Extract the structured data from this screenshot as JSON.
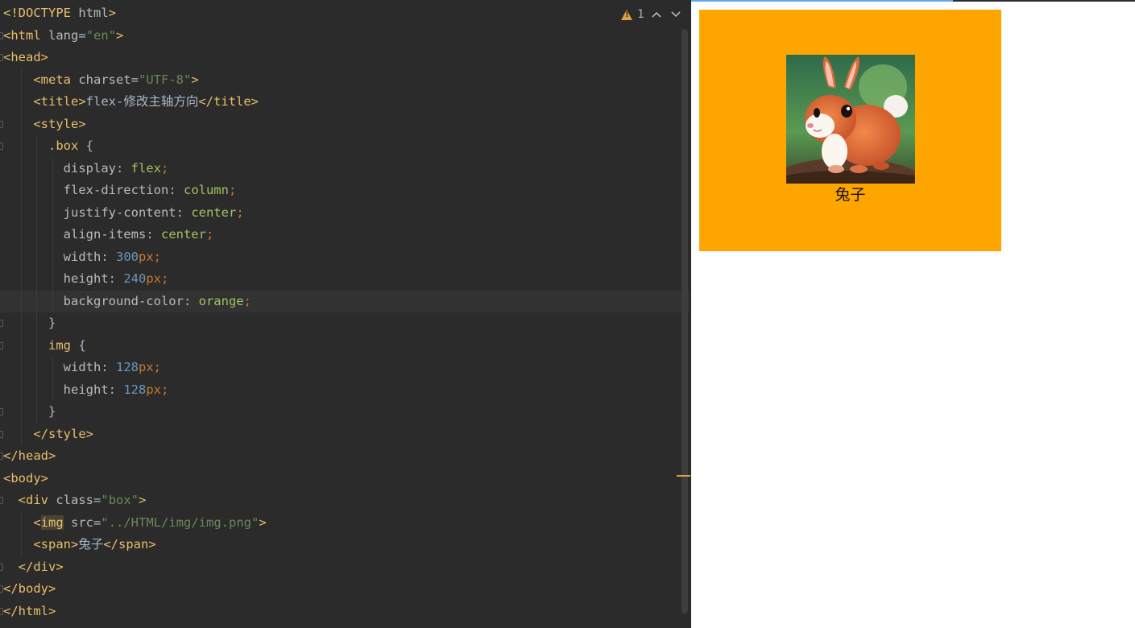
{
  "editor": {
    "inspections": {
      "warning_count": "1"
    },
    "lines": [
      {
        "indent": "",
        "tokens": [
          [
            "t-tag",
            "<!DOCTYPE "
          ],
          [
            "t-attr",
            "html"
          ],
          [
            "t-tag",
            ">"
          ]
        ]
      },
      {
        "indent": "",
        "tokens": [
          [
            "t-tag",
            "<html "
          ],
          [
            "t-attr",
            "lang"
          ],
          [
            "t-txt",
            "="
          ],
          [
            "t-str",
            "\"en\""
          ],
          [
            "t-tag",
            ">"
          ]
        ]
      },
      {
        "indent": "",
        "tokens": [
          [
            "t-tag",
            "<head>"
          ]
        ]
      },
      {
        "indent": "    ",
        "tokens": [
          [
            "t-tag",
            "<meta "
          ],
          [
            "t-attr",
            "charset"
          ],
          [
            "t-txt",
            "="
          ],
          [
            "t-str",
            "\"UTF-8\""
          ],
          [
            "t-tag",
            ">"
          ]
        ]
      },
      {
        "indent": "    ",
        "tokens": [
          [
            "t-tag",
            "<title>"
          ],
          [
            "t-txt",
            "flex-修改主轴方向"
          ],
          [
            "t-tag",
            "</title>"
          ]
        ]
      },
      {
        "indent": "    ",
        "tokens": [
          [
            "t-tag",
            "<style>"
          ]
        ]
      },
      {
        "indent": "      ",
        "tokens": [
          [
            "t-sel",
            ".box "
          ],
          [
            "t-txt",
            "{"
          ]
        ]
      },
      {
        "indent": "        ",
        "tokens": [
          [
            "t-prop",
            "display"
          ],
          [
            "t-txt",
            ": "
          ],
          [
            "t-val",
            "flex"
          ],
          [
            "t-punct",
            ";"
          ]
        ]
      },
      {
        "indent": "        ",
        "tokens": [
          [
            "t-prop",
            "flex-direction"
          ],
          [
            "t-txt",
            ": "
          ],
          [
            "t-val",
            "column"
          ],
          [
            "t-punct",
            ";"
          ]
        ]
      },
      {
        "indent": "        ",
        "tokens": [
          [
            "t-prop",
            "justify-content"
          ],
          [
            "t-txt",
            ": "
          ],
          [
            "t-val",
            "center"
          ],
          [
            "t-punct",
            ";"
          ]
        ]
      },
      {
        "indent": "        ",
        "tokens": [
          [
            "t-prop",
            "align-items"
          ],
          [
            "t-txt",
            ": "
          ],
          [
            "t-val",
            "center"
          ],
          [
            "t-punct",
            ";"
          ]
        ]
      },
      {
        "indent": "        ",
        "tokens": [
          [
            "t-prop",
            "width"
          ],
          [
            "t-txt",
            ": "
          ],
          [
            "t-num",
            "300"
          ],
          [
            "t-unit",
            "px"
          ],
          [
            "t-punct",
            ";"
          ]
        ]
      },
      {
        "indent": "        ",
        "tokens": [
          [
            "t-prop",
            "height"
          ],
          [
            "t-txt",
            ": "
          ],
          [
            "t-num",
            "240"
          ],
          [
            "t-unit",
            "px"
          ],
          [
            "t-punct",
            ";"
          ]
        ]
      },
      {
        "indent": "        ",
        "tokens": [
          [
            "t-prop",
            "background-color"
          ],
          [
            "t-txt",
            ": "
          ],
          [
            "t-val",
            "orange"
          ],
          [
            "t-punct",
            ";"
          ]
        ],
        "current": true
      },
      {
        "indent": "      ",
        "tokens": [
          [
            "t-txt",
            "}"
          ]
        ]
      },
      {
        "indent": "      ",
        "tokens": [
          [
            "t-sel",
            "img "
          ],
          [
            "t-txt",
            "{"
          ]
        ]
      },
      {
        "indent": "        ",
        "tokens": [
          [
            "t-prop",
            "width"
          ],
          [
            "t-txt",
            ": "
          ],
          [
            "t-num",
            "128"
          ],
          [
            "t-unit",
            "px"
          ],
          [
            "t-punct",
            ";"
          ]
        ]
      },
      {
        "indent": "        ",
        "tokens": [
          [
            "t-prop",
            "height"
          ],
          [
            "t-txt",
            ": "
          ],
          [
            "t-num",
            "128"
          ],
          [
            "t-unit",
            "px"
          ],
          [
            "t-punct",
            ";"
          ]
        ]
      },
      {
        "indent": "      ",
        "tokens": [
          [
            "t-txt",
            "}"
          ]
        ]
      },
      {
        "indent": "    ",
        "tokens": [
          [
            "t-tag",
            "</style>"
          ]
        ]
      },
      {
        "indent": "",
        "tokens": [
          [
            "t-tag",
            "</head>"
          ]
        ]
      },
      {
        "indent": "",
        "tokens": [
          [
            "t-tag",
            "<body>"
          ]
        ]
      },
      {
        "indent": "  ",
        "tokens": [
          [
            "t-tag",
            "<div "
          ],
          [
            "t-attr",
            "class"
          ],
          [
            "t-txt",
            "="
          ],
          [
            "t-str",
            "\"box\""
          ],
          [
            "t-tag",
            ">"
          ]
        ]
      },
      {
        "indent": "    ",
        "tokens": [
          [
            "t-tag",
            "<"
          ],
          [
            "t-hl",
            "img"
          ],
          [
            "t-tag",
            " "
          ],
          [
            "t-attr",
            "src"
          ],
          [
            "t-txt",
            "="
          ],
          [
            "t-str",
            "\"../HTML/img/img.png\""
          ],
          [
            "t-tag",
            ">"
          ]
        ]
      },
      {
        "indent": "    ",
        "tokens": [
          [
            "t-tag",
            "<span>"
          ],
          [
            "t-txt",
            "兔子"
          ],
          [
            "t-tag",
            "</span>"
          ]
        ]
      },
      {
        "indent": "  ",
        "tokens": [
          [
            "t-tag",
            "</div>"
          ]
        ]
      },
      {
        "indent": "",
        "tokens": [
          [
            "t-tag",
            "</body>"
          ]
        ]
      },
      {
        "indent": "",
        "tokens": [
          [
            "t-tag",
            "</html>"
          ]
        ]
      }
    ],
    "fold_markers": [
      1,
      2,
      5,
      6,
      14,
      15,
      18,
      19,
      20,
      22,
      25,
      26,
      27
    ]
  },
  "preview": {
    "box_color": "#ffa500",
    "image_icon": "rabbit-image",
    "label": "兔子"
  }
}
